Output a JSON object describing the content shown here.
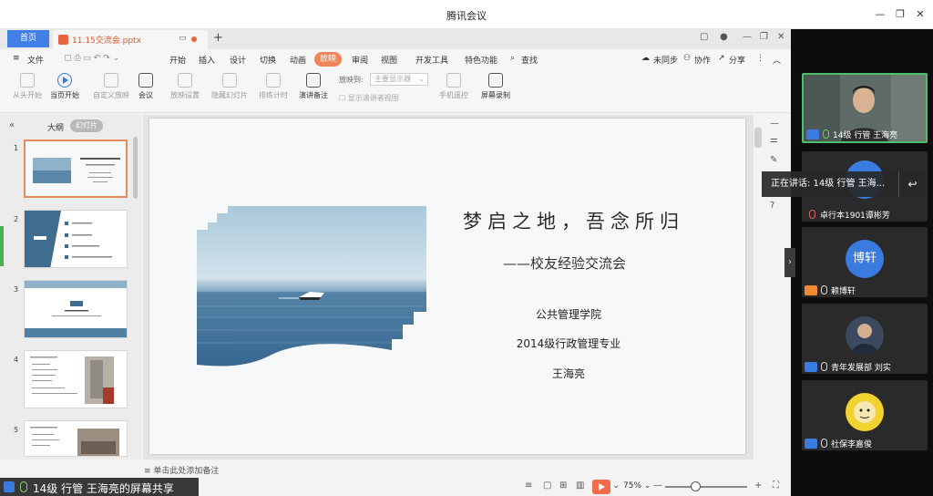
{
  "meeting": {
    "title": "腾讯会议",
    "window_controls": [
      "—",
      "❐",
      "✕"
    ]
  },
  "wps": {
    "home_tab": "首页",
    "file_tab": "11.15交流会.pptx",
    "menu_file": "文件",
    "menus": [
      "开始",
      "插入",
      "设计",
      "切换",
      "动画",
      "放映",
      "审阅",
      "视图",
      "开发工具",
      "特色功能"
    ],
    "active_menu": "放映",
    "search": "查找",
    "sync": "未同步",
    "collab": "协作",
    "share": "分享",
    "ribbon": {
      "from_start": "从头开始",
      "from_current": "当页开始",
      "custom_show": "自定义放映",
      "meeting": "会议",
      "show_settings": "放映设置",
      "hide_slide": "隐藏幻灯片",
      "rehearse": "排练计时",
      "presenter_notes": "演讲备注",
      "show_to_label": "放映到:",
      "show_to_value": "主要显示器",
      "show_presenter_view": "显示演讲者视图",
      "remote": "手机遥控",
      "screen_record": "屏幕录制"
    },
    "panel": {
      "outline": "大纲",
      "slides": "幻灯片",
      "numbers": [
        "1",
        "2",
        "3",
        "4",
        "5"
      ]
    },
    "slide": {
      "title": "梦启之地，吾念所归",
      "subtitle": "——校友经验交流会",
      "line1": "公共管理学院",
      "line2": "2014级行政管理专业",
      "line3": "王海亮"
    },
    "notes_placeholder": "单击此处添加备注",
    "zoom": "75%",
    "share_label": "14级 行管 王海亮的屏幕共享"
  },
  "participants": {
    "speaking": "正在讲话: 14级 行管 王海...",
    "list": [
      {
        "name": "14级 行管 王海亮"
      },
      {
        "name": "卓行本1901谭彬芳"
      },
      {
        "name": "赖博轩",
        "avatar_text": "博轩"
      },
      {
        "name": "青年发展部 刘实"
      },
      {
        "name": "社保李嘉俊"
      }
    ]
  }
}
